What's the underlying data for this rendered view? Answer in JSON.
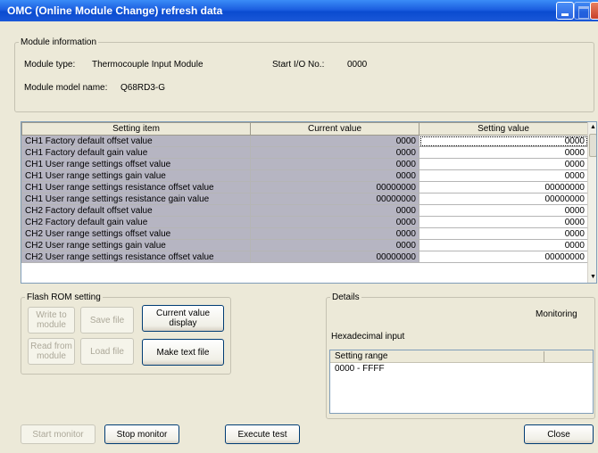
{
  "window": {
    "title": "OMC (Online Module Change) refresh data"
  },
  "module_info": {
    "legend": "Module information",
    "type_label": "Module type:",
    "type_value": "Thermocouple Input Module",
    "start_io_label": "Start I/O No.:",
    "start_io_value": "0000",
    "model_label": "Module model name:",
    "model_value": "Q68RD3-G"
  },
  "grid": {
    "headers": [
      "Setting item",
      "Current value",
      "Setting value"
    ],
    "rows": [
      {
        "item": "CH1 Factory default offset value",
        "current": "0000",
        "setting": "0000"
      },
      {
        "item": "CH1 Factory default gain value",
        "current": "0000",
        "setting": "0000"
      },
      {
        "item": "CH1 User range settings offset value",
        "current": "0000",
        "setting": "0000"
      },
      {
        "item": "CH1 User range settings gain value",
        "current": "0000",
        "setting": "0000"
      },
      {
        "item": "CH1 User range settings resistance offset value",
        "current": "00000000",
        "setting": "00000000"
      },
      {
        "item": "CH1 User range settings resistance gain value",
        "current": "00000000",
        "setting": "00000000"
      },
      {
        "item": "CH2 Factory default offset value",
        "current": "0000",
        "setting": "0000"
      },
      {
        "item": "CH2 Factory default gain value",
        "current": "0000",
        "setting": "0000"
      },
      {
        "item": "CH2 User range settings offset value",
        "current": "0000",
        "setting": "0000"
      },
      {
        "item": "CH2 User range settings gain value",
        "current": "0000",
        "setting": "0000"
      },
      {
        "item": "CH2 User range settings resistance offset value",
        "current": "00000000",
        "setting": "00000000"
      }
    ]
  },
  "flash_rom": {
    "legend": "Flash ROM setting",
    "write_to_module": "Write to module",
    "save_file": "Save file",
    "read_from_module": "Read from module",
    "load_file": "Load file"
  },
  "current_value_display": "Current value display",
  "make_text_file": "Make text file",
  "details": {
    "legend": "Details",
    "status": "Monitoring",
    "input_mode": "Hexadecimal input",
    "range_header": "Setting range",
    "range_value": "0000 - FFFF"
  },
  "bottom": {
    "start_monitor": "Start monitor",
    "stop_monitor": "Stop monitor",
    "execute_test": "Execute test",
    "close": "Close"
  }
}
